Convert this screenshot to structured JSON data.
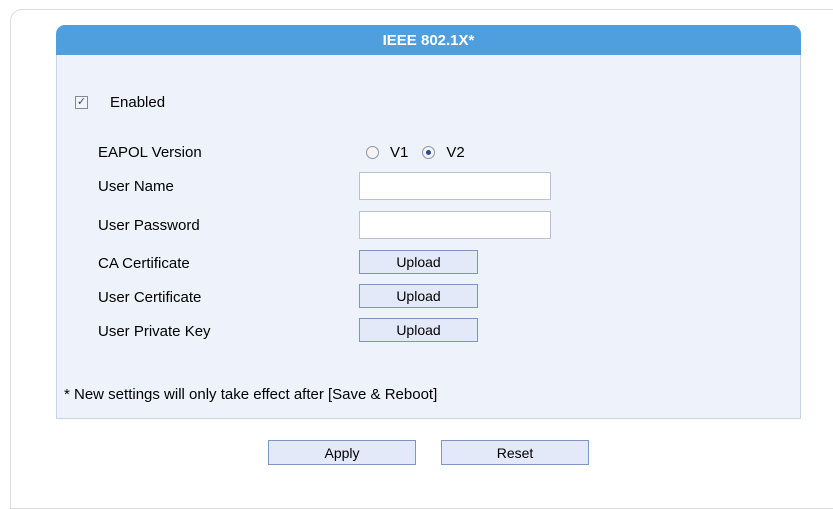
{
  "section": {
    "title": "IEEE 802.1X*"
  },
  "enabled": {
    "label": "Enabled",
    "checked": true
  },
  "eapol": {
    "label": "EAPOL Version",
    "options": [
      "V1",
      "V2"
    ],
    "selected": "V2"
  },
  "user_name": {
    "label": "User Name",
    "value": ""
  },
  "user_password": {
    "label": "User Password",
    "value": ""
  },
  "ca_certificate": {
    "label": "CA Certificate",
    "button": "Upload"
  },
  "user_certificate": {
    "label": "User Certificate",
    "button": "Upload"
  },
  "user_private_key": {
    "label": "User Private Key",
    "button": "Upload"
  },
  "note": "* New settings will only take effect after [Save & Reboot]",
  "actions": {
    "apply": "Apply",
    "reset": "Reset"
  },
  "colors": {
    "header": "#4f9fde",
    "panel": "#eef2fb",
    "button": "#e3e9f8"
  }
}
